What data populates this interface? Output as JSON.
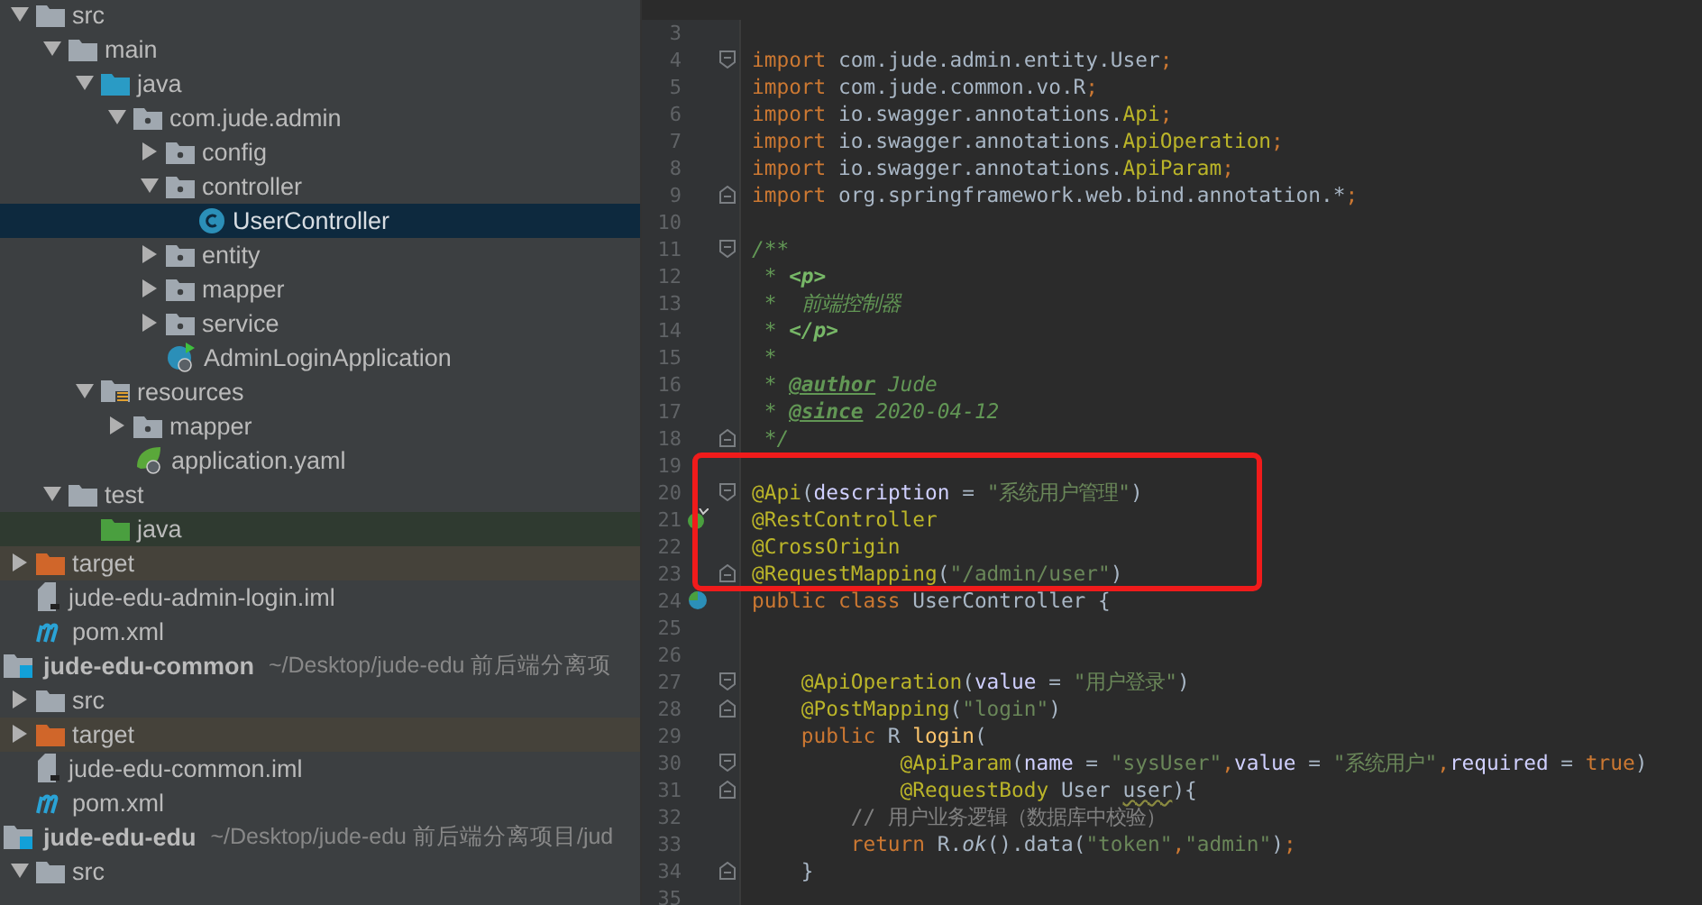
{
  "project_tree": [
    {
      "label": "src",
      "kind": "folder",
      "expanded": true,
      "selected": false,
      "children": [
        {
          "label": "main",
          "kind": "folder",
          "expanded": true,
          "selected": false,
          "children": [
            {
              "label": "java",
              "kind": "source-folder",
              "expanded": true,
              "selected": false,
              "children": [
                {
                  "label": "com.jude.admin",
                  "kind": "package",
                  "expanded": true,
                  "selected": false,
                  "children": [
                    {
                      "label": "config",
                      "kind": "package",
                      "expanded": false,
                      "selected": false
                    },
                    {
                      "label": "controller",
                      "kind": "package",
                      "expanded": true,
                      "selected": false,
                      "children": [
                        {
                          "label": "UserController",
                          "kind": "class",
                          "selected": true
                        }
                      ]
                    },
                    {
                      "label": "entity",
                      "kind": "package",
                      "expanded": false,
                      "selected": false
                    },
                    {
                      "label": "mapper",
                      "kind": "package",
                      "expanded": false,
                      "selected": false
                    },
                    {
                      "label": "service",
                      "kind": "package",
                      "expanded": false,
                      "selected": false
                    },
                    {
                      "label": "AdminLoginApplication",
                      "kind": "app-class",
                      "selected": false
                    }
                  ]
                }
              ]
            },
            {
              "label": "resources",
              "kind": "resources-folder",
              "expanded": true,
              "selected": false,
              "children": [
                {
                  "label": "mapper",
                  "kind": "package",
                  "expanded": false,
                  "selected": false
                },
                {
                  "label": "application.yaml",
                  "kind": "yaml",
                  "selected": false
                }
              ]
            }
          ]
        },
        {
          "label": "test",
          "kind": "folder",
          "expanded": true,
          "selected": false,
          "children": [
            {
              "label": "java",
              "kind": "test-folder",
              "selected": false
            }
          ]
        }
      ]
    },
    {
      "label": "target",
      "kind": "excluded-folder",
      "expanded": false,
      "selected": false
    },
    {
      "label": "jude-edu-admin-login.iml",
      "kind": "iml",
      "selected": false
    },
    {
      "label": "pom.xml",
      "kind": "maven",
      "selected": false
    },
    {
      "label": "jude-edu-common",
      "path": "~/Desktop/jude-edu 前后端分离项",
      "kind": "module",
      "selected": false,
      "children": [
        {
          "label": "src",
          "kind": "folder",
          "expanded": false,
          "selected": false
        },
        {
          "label": "target",
          "kind": "excluded-folder",
          "expanded": false,
          "selected": false
        },
        {
          "label": "jude-edu-common.iml",
          "kind": "iml",
          "selected": false
        },
        {
          "label": "pom.xml",
          "kind": "maven",
          "selected": false
        }
      ]
    },
    {
      "label": "jude-edu-edu",
      "path": "~/Desktop/jude-edu 前后端分离项目/jud",
      "kind": "module",
      "selected": false,
      "children": [
        {
          "label": "src",
          "kind": "folder",
          "expanded": true,
          "selected": false
        }
      ]
    }
  ],
  "editor": {
    "lines": [
      {
        "number": "3",
        "kind": "plain",
        "fold_start": false,
        "fold_end": false
      },
      {
        "number": "4",
        "kind": "plain",
        "fold_start": true,
        "fold_end": false,
        "tokens": [
          {
            "kind": "keyword",
            "text": "import"
          },
          {
            "kind": "plain",
            "text": " com.jude.admin.entity.User"
          },
          {
            "kind": "keyword",
            "text": ";"
          }
        ]
      },
      {
        "number": "5",
        "kind": "plain",
        "fold_start": false,
        "fold_end": false,
        "tokens": [
          {
            "kind": "keyword",
            "text": "import"
          },
          {
            "kind": "plain",
            "text": " com.jude.common.vo.R"
          },
          {
            "kind": "keyword",
            "text": ";"
          }
        ]
      },
      {
        "number": "6",
        "kind": "plain",
        "fold_start": false,
        "fold_end": false,
        "tokens": [
          {
            "kind": "keyword",
            "text": "import"
          },
          {
            "kind": "plain",
            "text": " io.swagger.annotations."
          },
          {
            "kind": "annotation",
            "text": "Api"
          },
          {
            "kind": "keyword",
            "text": ";"
          }
        ]
      },
      {
        "number": "7",
        "kind": "plain",
        "fold_start": false,
        "fold_end": false,
        "tokens": [
          {
            "kind": "keyword",
            "text": "import"
          },
          {
            "kind": "plain",
            "text": " io.swagger.annotations."
          },
          {
            "kind": "annotation",
            "text": "ApiOperation"
          },
          {
            "kind": "keyword",
            "text": ";"
          }
        ]
      },
      {
        "number": "8",
        "kind": "plain",
        "fold_start": false,
        "fold_end": false,
        "tokens": [
          {
            "kind": "keyword",
            "text": "import"
          },
          {
            "kind": "plain",
            "text": " io.swagger.annotations."
          },
          {
            "kind": "annotation",
            "text": "ApiParam"
          },
          {
            "kind": "keyword",
            "text": ";"
          }
        ]
      },
      {
        "number": "9",
        "kind": "plain",
        "fold_start": false,
        "fold_end": true,
        "tokens": [
          {
            "kind": "keyword",
            "text": "import"
          },
          {
            "kind": "plain",
            "text": " org.springframework.web.bind.annotation.*"
          },
          {
            "kind": "keyword",
            "text": ";"
          }
        ]
      },
      {
        "number": "10",
        "kind": "plain",
        "fold_start": false,
        "fold_end": false
      },
      {
        "number": "11",
        "kind": "plain",
        "fold_start": true,
        "fold_end": false,
        "tokens": [
          {
            "kind": "doc",
            "text": "/**"
          }
        ]
      },
      {
        "number": "12",
        "kind": "plain",
        "fold_start": false,
        "fold_end": false,
        "tokens": [
          {
            "kind": "doc",
            "text": " * "
          },
          {
            "kind": "doc-tag",
            "text": "<p>"
          }
        ]
      },
      {
        "number": "13",
        "kind": "plain",
        "fold_start": false,
        "fold_end": false,
        "tokens": [
          {
            "kind": "doc",
            "text": " *  前端控制器"
          }
        ]
      },
      {
        "number": "14",
        "kind": "plain",
        "fold_start": false,
        "fold_end": false,
        "tokens": [
          {
            "kind": "doc",
            "text": " * "
          },
          {
            "kind": "doc-tag",
            "text": "</p>"
          }
        ]
      },
      {
        "number": "15",
        "kind": "plain",
        "fold_start": false,
        "fold_end": false,
        "tokens": [
          {
            "kind": "doc",
            "text": " *"
          }
        ]
      },
      {
        "number": "16",
        "kind": "plain",
        "fold_start": false,
        "fold_end": false,
        "tokens": [
          {
            "kind": "doc",
            "text": " * "
          },
          {
            "kind": "doc-at",
            "text": "@author"
          },
          {
            "kind": "doc",
            "text": " Jude"
          }
        ]
      },
      {
        "number": "17",
        "kind": "plain",
        "fold_start": false,
        "fold_end": false,
        "tokens": [
          {
            "kind": "doc",
            "text": " * "
          },
          {
            "kind": "doc-at",
            "text": "@since"
          },
          {
            "kind": "doc",
            "text": " 2020-04-12"
          }
        ]
      },
      {
        "number": "18",
        "kind": "plain",
        "fold_start": false,
        "fold_end": true,
        "tokens": [
          {
            "kind": "doc",
            "text": " */"
          }
        ]
      },
      {
        "number": "19",
        "kind": "plain",
        "fold_start": false,
        "fold_end": false
      },
      {
        "number": "20",
        "kind": "plain",
        "fold_start": true,
        "fold_end": false,
        "tokens": [
          {
            "kind": "annotation",
            "text": "@Api"
          },
          {
            "kind": "plain",
            "text": "("
          },
          {
            "kind": "param",
            "text": "description"
          },
          {
            "kind": "plain",
            "text": " = "
          },
          {
            "kind": "string",
            "text": "\"系统用户管理\""
          },
          {
            "kind": "plain",
            "text": ")"
          }
        ]
      },
      {
        "number": "21",
        "kind": "bean",
        "fold_start": false,
        "fold_end": false,
        "tokens": [
          {
            "kind": "annotation",
            "text": "@RestController"
          }
        ]
      },
      {
        "number": "22",
        "kind": "plain",
        "fold_start": false,
        "fold_end": false,
        "tokens": [
          {
            "kind": "annotation",
            "text": "@CrossOrigin"
          }
        ]
      },
      {
        "number": "23",
        "kind": "plain",
        "fold_start": false,
        "fold_end": true,
        "tokens": [
          {
            "kind": "annotation",
            "text": "@RequestMapping"
          },
          {
            "kind": "plain",
            "text": "("
          },
          {
            "kind": "string",
            "text": "\"/admin/user\""
          },
          {
            "kind": "plain",
            "text": ")"
          }
        ]
      },
      {
        "number": "24",
        "kind": "class",
        "fold_start": false,
        "fold_end": false,
        "tokens": [
          {
            "kind": "keyword",
            "text": "public class"
          },
          {
            "kind": "plain",
            "text": " UserController {"
          }
        ]
      },
      {
        "number": "25",
        "kind": "plain",
        "fold_start": false,
        "fold_end": false
      },
      {
        "number": "26",
        "kind": "plain",
        "fold_start": false,
        "fold_end": false
      },
      {
        "number": "27",
        "kind": "plain",
        "fold_start": true,
        "fold_end": false,
        "tokens": [
          {
            "kind": "annotation",
            "text": "    @ApiOperation"
          },
          {
            "kind": "plain",
            "text": "("
          },
          {
            "kind": "param",
            "text": "value"
          },
          {
            "kind": "plain",
            "text": " = "
          },
          {
            "kind": "string",
            "text": "\"用户登录\""
          },
          {
            "kind": "plain",
            "text": ")"
          }
        ]
      },
      {
        "number": "28",
        "kind": "plain",
        "fold_start": false,
        "fold_end": true,
        "tokens": [
          {
            "kind": "annotation",
            "text": "    @PostMapping"
          },
          {
            "kind": "plain",
            "text": "("
          },
          {
            "kind": "string",
            "text": "\"login\""
          },
          {
            "kind": "plain",
            "text": ")"
          }
        ]
      },
      {
        "number": "29",
        "kind": "plain",
        "fold_start": false,
        "fold_end": false,
        "tokens": [
          {
            "kind": "keyword",
            "text": "    public"
          },
          {
            "kind": "plain",
            "text": " R "
          },
          {
            "kind": "method",
            "text": "login"
          },
          {
            "kind": "plain",
            "text": "("
          }
        ]
      },
      {
        "number": "30",
        "kind": "plain",
        "fold_start": true,
        "fold_end": false,
        "tokens": [
          {
            "kind": "annotation",
            "text": "            @ApiParam"
          },
          {
            "kind": "plain",
            "text": "("
          },
          {
            "kind": "param",
            "text": "name"
          },
          {
            "kind": "plain",
            "text": " = "
          },
          {
            "kind": "string",
            "text": "\"sysUser\""
          },
          {
            "kind": "keyword",
            "text": ","
          },
          {
            "kind": "param",
            "text": "value"
          },
          {
            "kind": "plain",
            "text": " = "
          },
          {
            "kind": "string",
            "text": "\"系统用户\""
          },
          {
            "kind": "keyword",
            "text": ","
          },
          {
            "kind": "param",
            "text": "required"
          },
          {
            "kind": "plain",
            "text": " = "
          },
          {
            "kind": "keyword",
            "text": "true"
          },
          {
            "kind": "plain",
            "text": ")"
          }
        ]
      },
      {
        "number": "31",
        "kind": "plain",
        "fold_start": false,
        "fold_end": true,
        "tokens": [
          {
            "kind": "annotation",
            "text": "            @RequestBody"
          },
          {
            "kind": "plain",
            "text": " User "
          },
          {
            "kind": "warn",
            "text": "user"
          },
          {
            "kind": "plain",
            "text": "){"
          }
        ]
      },
      {
        "number": "32",
        "kind": "plain",
        "fold_start": false,
        "fold_end": false,
        "tokens": [
          {
            "kind": "comment",
            "text": "        // 用户业务逻辑（数据库中校验）"
          }
        ]
      },
      {
        "number": "33",
        "kind": "plain",
        "fold_start": false,
        "fold_end": false,
        "tokens": [
          {
            "kind": "keyword",
            "text": "        return"
          },
          {
            "kind": "plain",
            "text": " R."
          },
          {
            "kind": "static",
            "text": "ok"
          },
          {
            "kind": "plain",
            "text": "().data("
          },
          {
            "kind": "string",
            "text": "\"token\""
          },
          {
            "kind": "keyword",
            "text": ","
          },
          {
            "kind": "string",
            "text": "\"admin\""
          },
          {
            "kind": "plain",
            "text": ")"
          },
          {
            "kind": "keyword",
            "text": ";"
          }
        ]
      },
      {
        "number": "34",
        "kind": "plain",
        "fold_start": false,
        "fold_end": true,
        "tokens": [
          {
            "kind": "plain",
            "text": "    }"
          }
        ]
      },
      {
        "number": "35",
        "kind": "plain",
        "fold_start": false,
        "fold_end": false
      }
    ]
  }
}
